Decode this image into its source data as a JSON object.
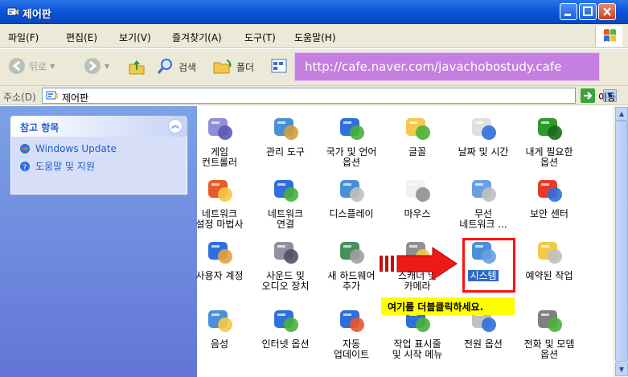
{
  "window": {
    "title": "제어판"
  },
  "menu": [
    "파일(F)",
    "편집(E)",
    "보기(V)",
    "즐겨찾기(A)",
    "도구(T)",
    "도움말(H)"
  ],
  "toolbar": {
    "back": "뒤로",
    "search": "검색",
    "folders": "폴더"
  },
  "overlay": {
    "url": "http://cafe.naver.com/javachobostudy.cafe"
  },
  "address": {
    "label": "주소(D)",
    "value": "제어판",
    "go": "이동"
  },
  "sidepanel": {
    "title": "참고 항목",
    "links": [
      "Windows Update",
      "도움말 및 지원"
    ]
  },
  "items": [
    {
      "label": "게임\n컨트롤러",
      "icon": "gamepad-icon"
    },
    {
      "label": "관리 도구",
      "icon": "admin-tools-icon"
    },
    {
      "label": "국가 및 언어\n옵션",
      "icon": "globe-icon"
    },
    {
      "label": "글꼴",
      "icon": "fonts-folder-icon"
    },
    {
      "label": "날짜 및 시간",
      "icon": "clock-icon"
    },
    {
      "label": "내게 필요한\n옵션",
      "icon": "accessibility-icon"
    },
    {
      "label": "네트워크\n설정 마법사",
      "icon": "network-wizard-icon"
    },
    {
      "label": "네트워크\n연결",
      "icon": "network-connections-icon"
    },
    {
      "label": "디스플레이",
      "icon": "display-icon"
    },
    {
      "label": "마우스",
      "icon": "mouse-icon"
    },
    {
      "label": "무선\n네트워크 ...",
      "icon": "wireless-icon"
    },
    {
      "label": "보안 센터",
      "icon": "security-shield-icon"
    },
    {
      "label": "사용자 계정",
      "icon": "user-accounts-icon"
    },
    {
      "label": "사운드 및\n오디오 장치",
      "icon": "speaker-icon"
    },
    {
      "label": "새 하드웨어\n추가",
      "icon": "add-hardware-icon"
    },
    {
      "label": "스캐너 및\n카메라",
      "icon": "scanner-camera-icon"
    },
    {
      "label": "시스템",
      "icon": "system-icon"
    },
    {
      "label": "예약된 작업",
      "icon": "scheduled-tasks-icon"
    },
    {
      "label": "음성",
      "icon": "speech-icon"
    },
    {
      "label": "인터넷 옵션",
      "icon": "internet-options-icon"
    },
    {
      "label": "자동\n업데이트",
      "icon": "auto-update-icon"
    },
    {
      "label": "작업 표시줄\n및 시작 메뉴",
      "icon": "taskbar-icon"
    },
    {
      "label": "전원 옵션",
      "icon": "power-options-icon"
    },
    {
      "label": "전화 및 모뎀\n옵션",
      "icon": "phone-modem-icon"
    }
  ],
  "annotation": {
    "callout": "여기를 더블클릭하세요."
  }
}
